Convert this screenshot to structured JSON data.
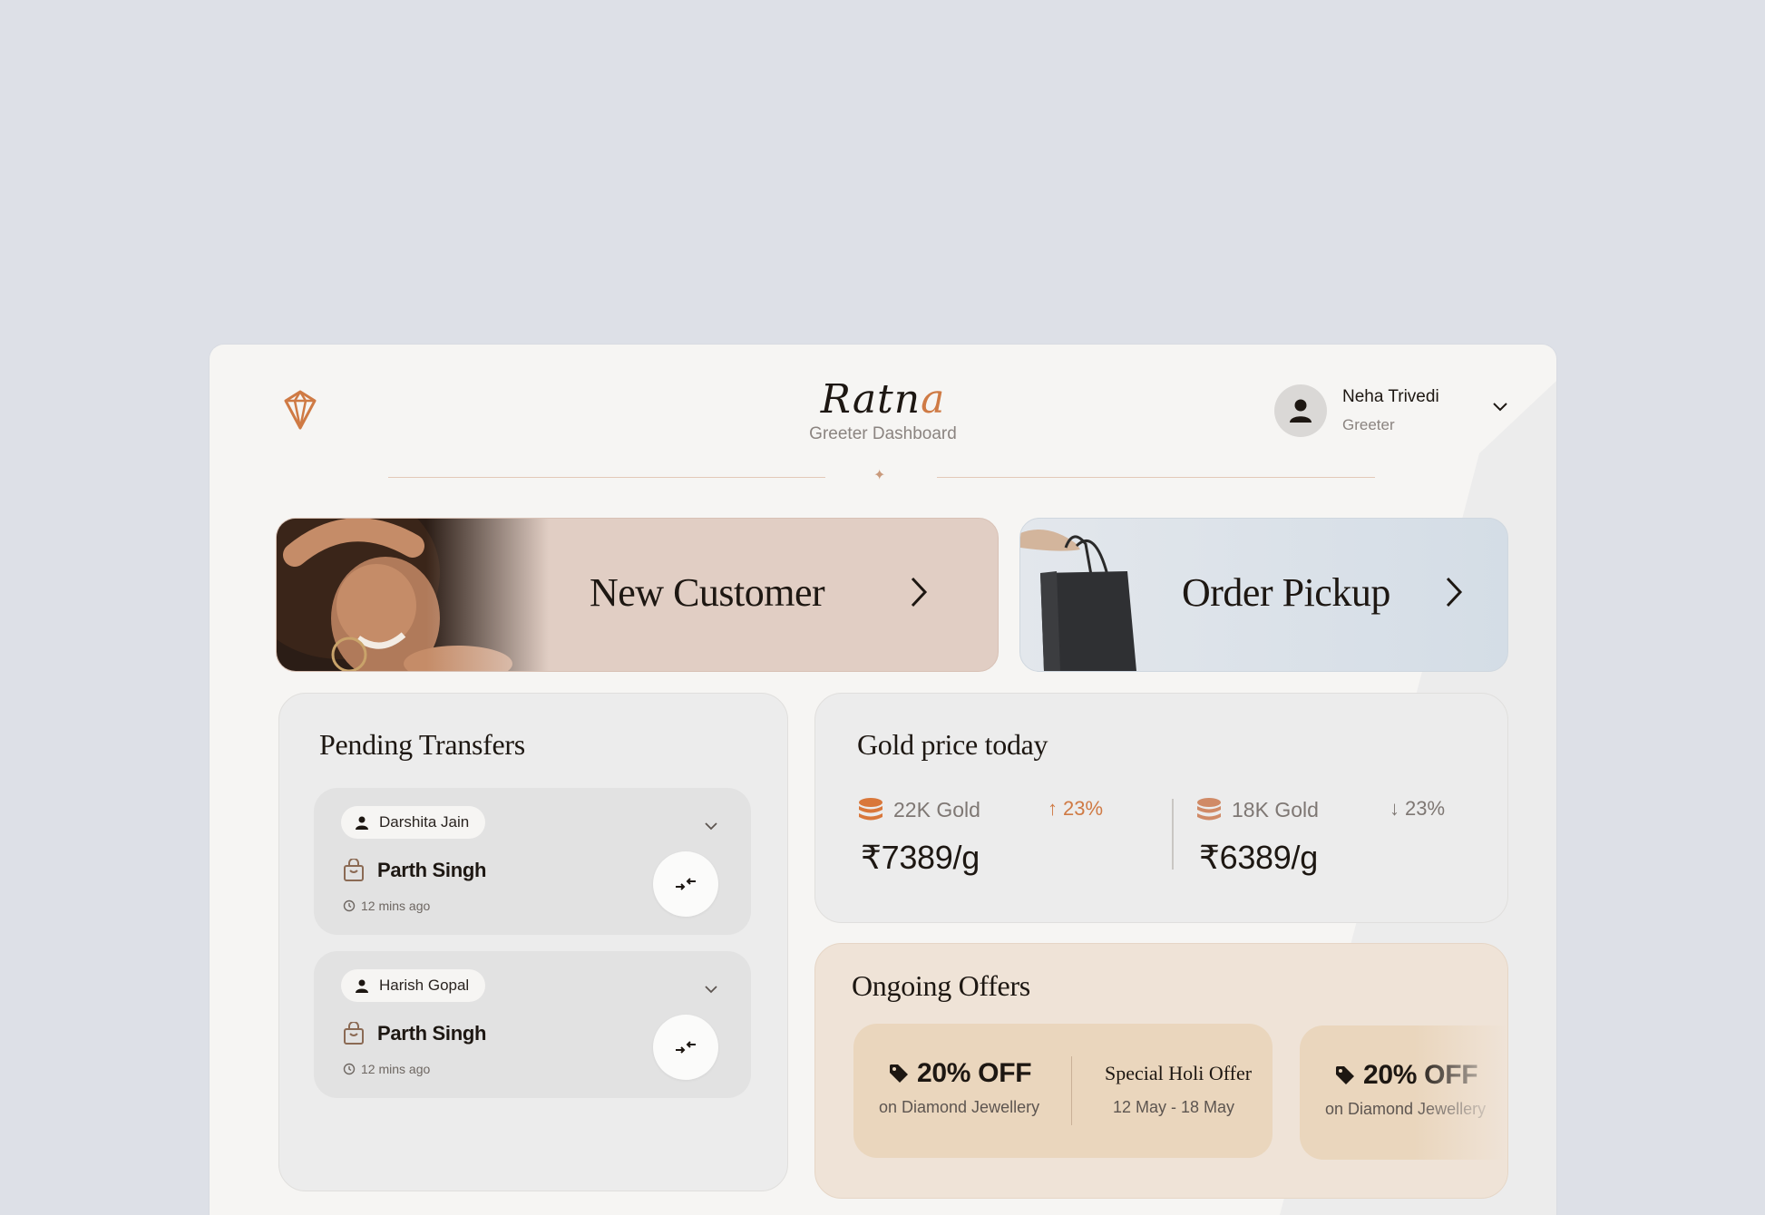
{
  "header": {
    "brand_main": "Ratn",
    "brand_accent": "a",
    "subtitle": "Greeter Dashboard",
    "logo_icon": "diamond-icon"
  },
  "user": {
    "name": "Neha Trivedi",
    "role": "Greeter",
    "avatar_icon": "person-icon"
  },
  "actions": {
    "new_customer": "New Customer",
    "order_pickup": "Order Pickup"
  },
  "pending": {
    "title": "Pending Transfers",
    "items": [
      {
        "customer": "Darshita Jain",
        "staff": "Parth Singh",
        "time": "12 mins ago"
      },
      {
        "customer": "Harish Gopal",
        "staff": "Parth Singh",
        "time": "12 mins ago"
      }
    ]
  },
  "gold": {
    "title": "Gold price today",
    "items": [
      {
        "label": "22K Gold",
        "change": "23%",
        "direction": "up",
        "price": "₹7389/g"
      },
      {
        "label": "18K Gold",
        "change": "23%",
        "direction": "down",
        "price": "₹6389/g"
      }
    ]
  },
  "offers": {
    "title": "Ongoing Offers",
    "items": [
      {
        "discount": "20% OFF",
        "subtitle": "on Diamond Jewellery",
        "name": "Special Holi Offer",
        "dates": "12 May - 18 May"
      },
      {
        "discount": "20% OFF",
        "subtitle": "on Diamond Jewellery"
      }
    ]
  },
  "colors": {
    "accent": "#cf7a44",
    "background": "#dde0e7",
    "surface": "#f6f5f3",
    "up": "#cf7a44",
    "down": "#7e7773"
  }
}
